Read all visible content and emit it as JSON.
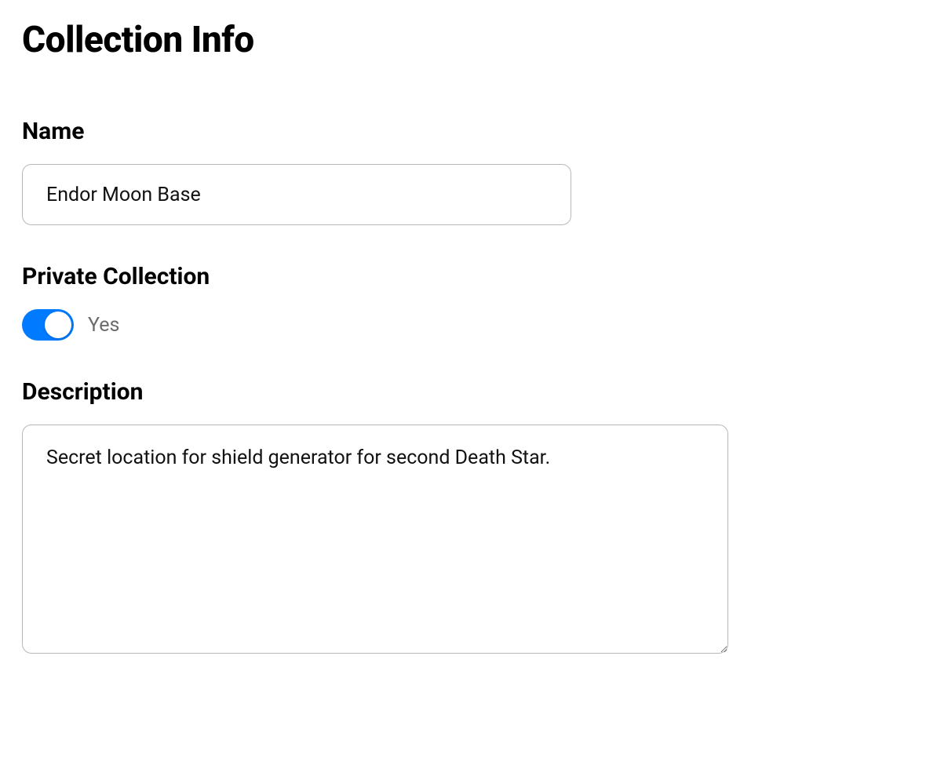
{
  "title": "Collection Info",
  "fields": {
    "name": {
      "label": "Name",
      "value": "Endor Moon Base"
    },
    "private": {
      "label": "Private Collection",
      "state_text": "Yes",
      "on": true
    },
    "description": {
      "label": "Description",
      "value": "Secret location for shield generator for second Death Star."
    }
  },
  "colors": {
    "accent": "#007aff"
  }
}
